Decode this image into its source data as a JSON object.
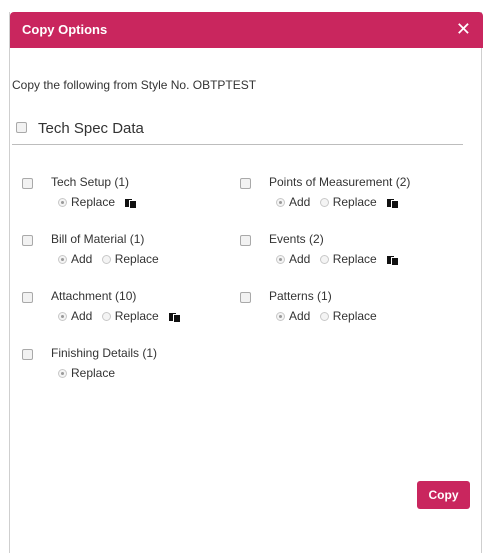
{
  "dialog": {
    "title": "Copy Options",
    "close_glyph": "✕",
    "intro": "Copy the following from Style No. OBTPTEST",
    "section_label": "Tech Spec Data",
    "copy_button": "Copy"
  },
  "items": {
    "tech_setup": {
      "name": "Tech Setup",
      "count": "(1)",
      "replace": "Replace"
    },
    "bom": {
      "name": "Bill of Material",
      "count": "(1)",
      "add": "Add",
      "replace": "Replace"
    },
    "attachment": {
      "name": "Attachment",
      "count": "(10)",
      "add": "Add",
      "replace": "Replace"
    },
    "finishing": {
      "name": "Finishing Details",
      "count": "(1)",
      "replace": "Replace"
    },
    "pom": {
      "name": "Points of Measurement",
      "count": "(2)",
      "add": "Add",
      "replace": "Replace"
    },
    "events": {
      "name": "Events",
      "count": "(2)",
      "add": "Add",
      "replace": "Replace"
    },
    "patterns": {
      "name": "Patterns",
      "count": "(1)",
      "add": "Add",
      "replace": "Replace"
    }
  },
  "colors": {
    "accent": "#c9265e",
    "text": "#333333",
    "divider": "#bdbdbd"
  },
  "icons": {
    "copy": "copy-icon",
    "close": "close-icon"
  }
}
